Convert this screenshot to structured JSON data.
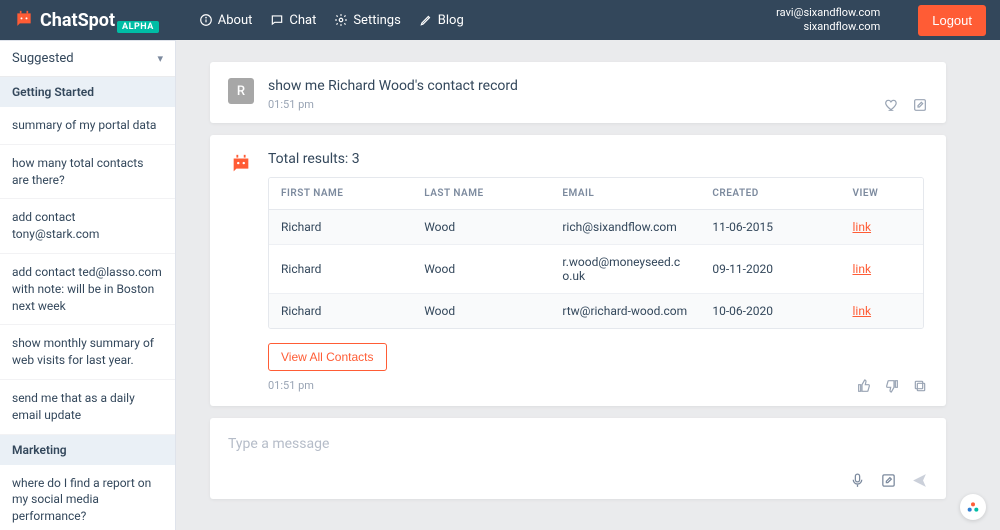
{
  "brand": {
    "name": "ChatSpot",
    "badge": "ALPHA"
  },
  "nav": {
    "about": "About",
    "chat": "Chat",
    "settings": "Settings",
    "blog": "Blog"
  },
  "user": {
    "email": "ravi@sixandflow.com",
    "org": "sixandflow.com"
  },
  "logout": "Logout",
  "sidebar": {
    "dropdown": "Suggested",
    "sections": [
      {
        "title": "Getting Started",
        "items": [
          "summary of my portal data",
          "how many total contacts are there?",
          "add contact tony@stark.com",
          "add contact ted@lasso.com with note: will be in Boston next week",
          "show monthly summary of web visits for last year.",
          "send me that as a daily email update"
        ]
      },
      {
        "title": "Marketing",
        "items": [
          "where do I find a report on my social media performance?"
        ]
      }
    ]
  },
  "query": {
    "avatar": "R",
    "text": "show me Richard Wood's contact record",
    "time": "01:51 pm"
  },
  "response": {
    "title": "Total results: 3",
    "columns": [
      "FIRST NAME",
      "LAST NAME",
      "EMAIL",
      "CREATED",
      "VIEW"
    ],
    "rows": [
      {
        "first": "Richard",
        "last": "Wood",
        "email": "rich@sixandflow.com",
        "created": "11-06-2015",
        "view": "link"
      },
      {
        "first": "Richard",
        "last": "Wood",
        "email": "r.wood@moneyseed.co.uk",
        "created": "09-11-2020",
        "view": "link"
      },
      {
        "first": "Richard",
        "last": "Wood",
        "email": "rtw@richard-wood.com",
        "created": "10-06-2020",
        "view": "link"
      }
    ],
    "viewAll": "View All Contacts",
    "time": "01:51 pm"
  },
  "input": {
    "placeholder": "Type a message"
  }
}
